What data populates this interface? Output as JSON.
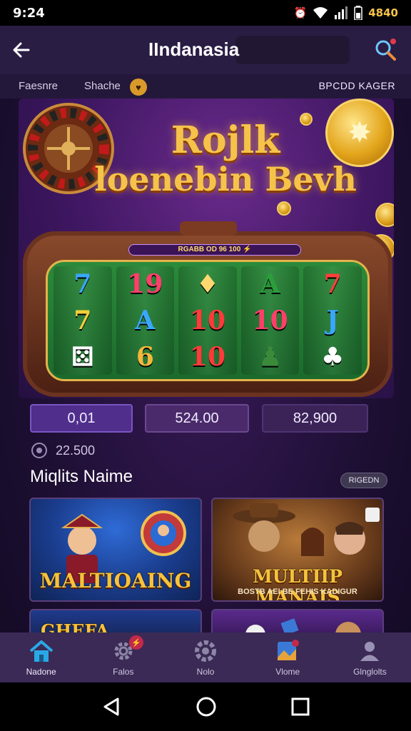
{
  "status_bar": {
    "time": "9:24",
    "battery": "4840"
  },
  "app_bar": {
    "title": "IIndanasia"
  },
  "sub_strip": {
    "left_a": "Faesnre",
    "left_b": "Shache",
    "badge": "♥",
    "right": "BPCDD KAGER"
  },
  "hero": {
    "title_line1": "Rojlk",
    "title_line2": "loenebin Bevh",
    "jackpot": "RGABB OD 96 100 ⚡",
    "reels": [
      [
        "7",
        "7",
        "⚄"
      ],
      [
        "19",
        "A",
        "6"
      ],
      [
        "♦",
        "10",
        "10"
      ],
      [
        "A",
        "10",
        "♟"
      ],
      [
        "7",
        "J",
        "♣"
      ]
    ],
    "reel_colors": [
      [
        "#3aa7ff",
        "#f3cf3b",
        "#ffffff"
      ],
      [
        "#ff3f6a",
        "#3aa7ff",
        "#f3b83b"
      ],
      [
        "#ffd870",
        "#ff3a3a",
        "#ff3a3a"
      ],
      [
        "#2a9e3a",
        "#ff3f6a",
        "#3a8a3a"
      ],
      [
        "#ff3f3a",
        "#3aa7ff",
        "#ffffff"
      ]
    ]
  },
  "stats": {
    "box1": "0,01",
    "box2": "524.00",
    "box3": "82,900"
  },
  "balance": {
    "value": "22.500"
  },
  "section": {
    "title": "Miqlits Naime",
    "button": "RIGEDN"
  },
  "cards": [
    {
      "label": "MALTIOAING"
    },
    {
      "label": "MULTIIP MANAIS",
      "sub": "BOSTB AEI BE FEHIS KADIGUR"
    },
    {
      "label": "GHEFA"
    },
    {
      "label": ""
    }
  ],
  "bottom_nav": [
    {
      "label": "Nadone",
      "icon": "home-icon"
    },
    {
      "label": "Falos",
      "icon": "gear-icon",
      "badge": "⚡"
    },
    {
      "label": "Nolo",
      "icon": "settings-icon"
    },
    {
      "label": "Vlome",
      "icon": "gallery-icon"
    },
    {
      "label": "Glnglolts",
      "icon": "profile-icon"
    }
  ]
}
